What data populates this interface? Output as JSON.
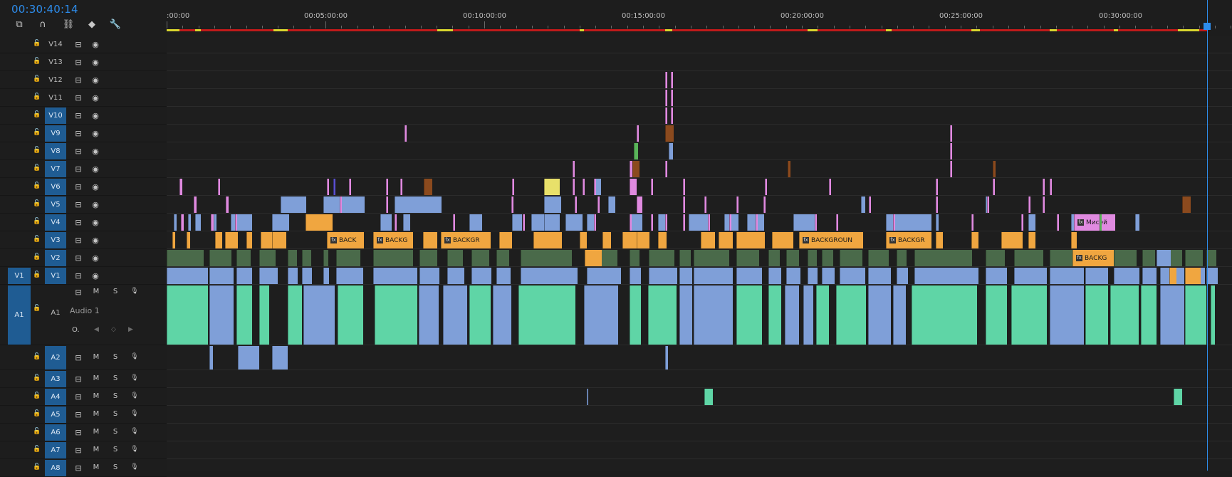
{
  "timecode": "00:30:40:14",
  "toolbar": [
    {
      "name": "nest-sequence-icon",
      "glyph": "⧉"
    },
    {
      "name": "snap-magnet-icon",
      "glyph": "∩"
    },
    {
      "name": "linked-selection-icon",
      "glyph": "⛓"
    },
    {
      "name": "add-marker-icon",
      "glyph": "◆"
    },
    {
      "name": "wrench-settings-icon",
      "glyph": "🔧"
    }
  ],
  "ruler_labels": [
    ":00:00",
    "00:05:00:00",
    "00:10:00:00",
    "00:15:00:00",
    "00:20:00:00",
    "00:25:00:00",
    "00:30:00:00"
  ],
  "video_tracks": [
    {
      "id": "V14",
      "target": false
    },
    {
      "id": "V13",
      "target": false
    },
    {
      "id": "V12",
      "target": false
    },
    {
      "id": "V11",
      "target": false
    },
    {
      "id": "V10",
      "target": true
    },
    {
      "id": "V9",
      "target": true
    },
    {
      "id": "V8",
      "target": true
    },
    {
      "id": "V7",
      "target": true
    },
    {
      "id": "V6",
      "target": true
    },
    {
      "id": "V5",
      "target": true
    },
    {
      "id": "V4",
      "target": true
    },
    {
      "id": "V3",
      "target": true
    },
    {
      "id": "V2",
      "target": true
    },
    {
      "id": "V1",
      "target": true,
      "source": "V1"
    }
  ],
  "audio_tracks": [
    {
      "id": "A1",
      "source": "A1",
      "name": "Audio 1",
      "expanded": true,
      "target": false
    },
    {
      "id": "A2",
      "target": true
    },
    {
      "id": "A3",
      "target": true
    },
    {
      "id": "A4",
      "target": true
    },
    {
      "id": "A5",
      "target": true
    },
    {
      "id": "A6",
      "target": true
    },
    {
      "id": "A7",
      "target": true
    },
    {
      "id": "A8",
      "target": true
    }
  ],
  "audio_buttons": {
    "mute": "M",
    "solo": "S"
  },
  "audio_keyframe_label": "O.",
  "clip_labels": {
    "back1": "BACK",
    "back2": "BACKG",
    "back3": "BACKGR",
    "back4": "BACKGROUN",
    "back5": "BACKGR",
    "back6": "BACKG",
    "misei": "Мисей"
  },
  "colors": {
    "accent": "#2d8ceb",
    "video_clip": "#7f9fd8",
    "audio_clip": "#5fd5a6",
    "orange_clip": "#f0a640",
    "pink_clip": "#e08ae0",
    "brown_clip": "#8b4a1e",
    "green_clip": "#5ab45a",
    "yellow_clip": "#e8e06a"
  }
}
